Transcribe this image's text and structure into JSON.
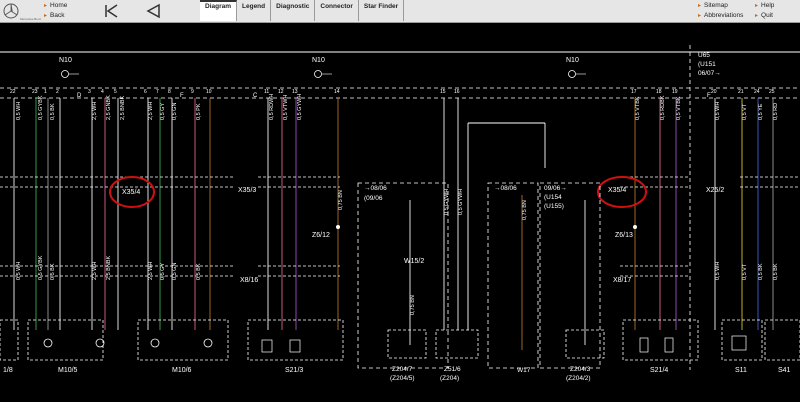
{
  "toolbar": {
    "nav": {
      "home": "Home",
      "back": "Back"
    },
    "tabs": [
      "Diagram",
      "Legend",
      "Diagnostic",
      "Connector",
      "Star Finder"
    ],
    "links": {
      "sitemap": "Sitemap",
      "abbreviations": "Abbreviations",
      "help": "Help",
      "quit": "Quit"
    }
  },
  "diagram": {
    "bus_labels": [
      "N10",
      "N10",
      "N10"
    ],
    "top_right_box": [
      "U65",
      "(U151",
      "06/07→"
    ],
    "connectors": [
      "X35/4",
      "X35/3",
      "X35/4",
      "X25/2",
      "X8/16",
      "X8/17"
    ],
    "splices": [
      "Z6/12",
      "Z6/13",
      "W15/2"
    ],
    "note_boxes": [
      {
        "label": "08/06",
        "sub": "(09/06"
      },
      {
        "label": "08/06",
        "sub": ""
      },
      {
        "label": "09/06",
        "sub": "(U154\n(U155)"
      }
    ],
    "components": [
      "M10/5",
      "M10/6",
      "S21/3",
      "Z204/7",
      "(Z204/5)",
      "Z51/6",
      "(Z204)",
      "W17",
      "Z204/3",
      "(Z204/2)",
      "S21/4",
      "S11",
      "S41",
      "1/8"
    ],
    "wire_labels": [
      "0,5 WH",
      "0,5 GYBK",
      "0,5 GNBK",
      "0,5 BK",
      "2,5 WH",
      "2,5 GNBK",
      "2,5 BNBK",
      "0,5 GY",
      "0,5 GN",
      "0,5 PK",
      "0,75 BN",
      "0,5 GYWH",
      "0,5 RDWH",
      "0,5 VTWH",
      "0,5 VTBK",
      "0,5 RDBK",
      "0,5 VT",
      "0,5 YE",
      "0,5 BU",
      "0,5 RD"
    ],
    "pin_numbers": [
      "22",
      "23",
      "1",
      "2",
      "3",
      "4",
      "5",
      "6",
      "7",
      "8",
      "9",
      "10",
      "11",
      "12",
      "13",
      "14",
      "15",
      "16",
      "17",
      "18",
      "19",
      "20",
      "21",
      "24",
      "25",
      "26",
      "27",
      "28",
      "29",
      "30",
      "31",
      "32"
    ],
    "letters": [
      "B",
      "D",
      "E",
      "F",
      "C",
      "F"
    ],
    "highlight_color": "#d01010",
    "wire_colors": {
      "white": "#f2f2f2",
      "pink": "#e0608a",
      "green": "#3aa84a",
      "brown": "#b0702a",
      "grey": "#9a9a9a",
      "violet": "#a050c0",
      "yellow": "#d8c020",
      "blue": "#4060d0"
    }
  }
}
